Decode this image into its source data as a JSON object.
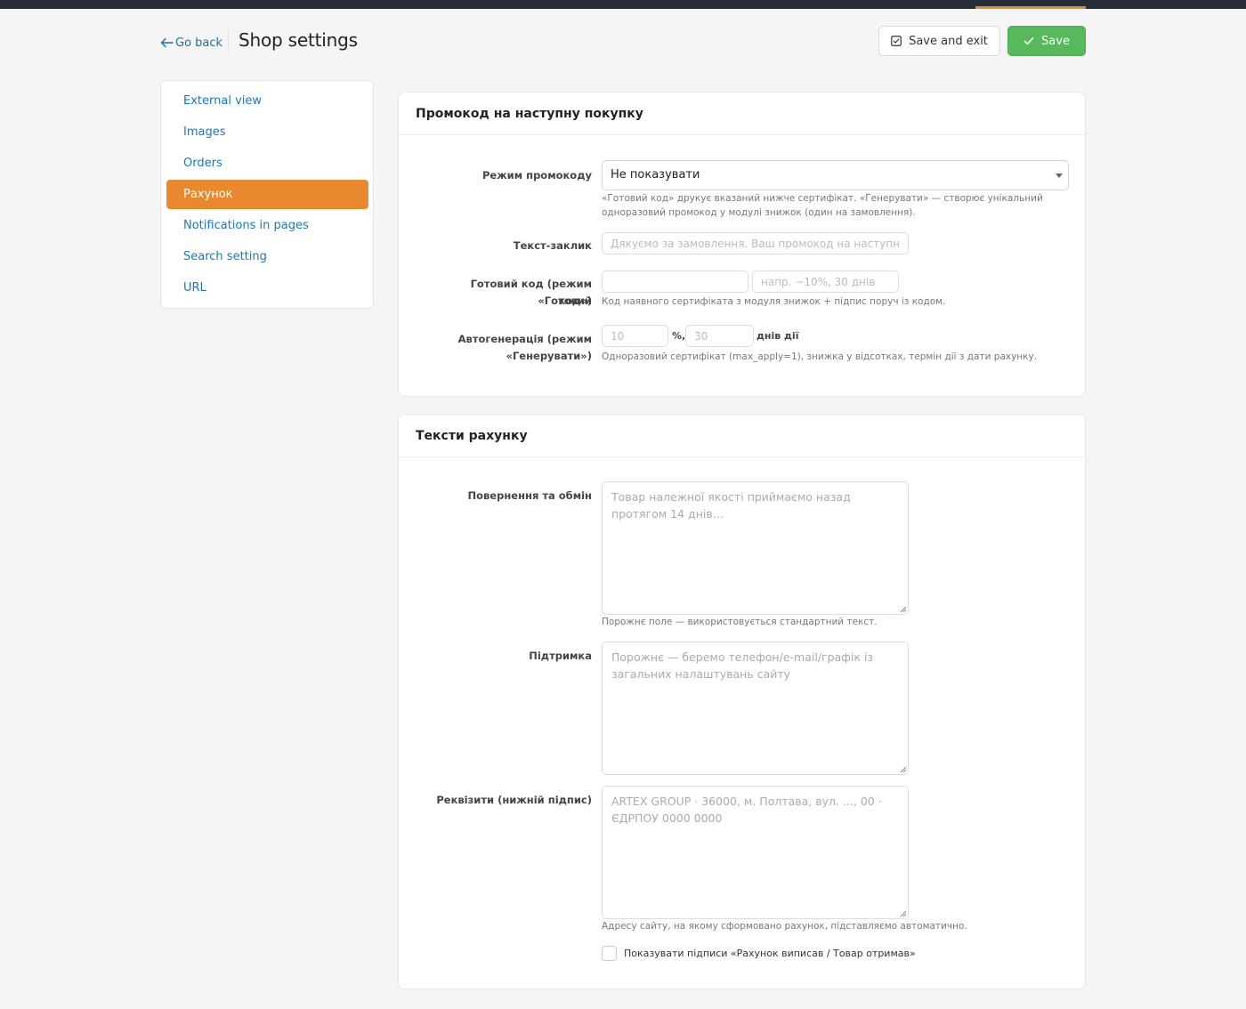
{
  "header": {
    "go_back": "Go back",
    "title": "Shop settings",
    "save_exit": "Save and exit",
    "save": "Save"
  },
  "sidebar": {
    "items": [
      {
        "label": "External view"
      },
      {
        "label": "Images"
      },
      {
        "label": "Orders"
      },
      {
        "label": "Рахунок",
        "active": true
      },
      {
        "label": "Notifications in pages"
      },
      {
        "label": "Search setting"
      },
      {
        "label": "URL"
      }
    ]
  },
  "promo": {
    "title": "Промокод на наступну покупку",
    "mode_label": "Режим промокоду",
    "mode_value": "Не показувати",
    "mode_hint_1": "«Готовий код» друкує вказаний нижче сертифікат. «Генерувати» — створює унікальний",
    "mode_hint_2": "одноразовий промокод у модулі знижок (один на замовлення).",
    "cta_label": "Текст-заклик",
    "cta_placeholder": "Дякуємо за замовлення. Ваш промокод на наступну покупку",
    "ready_label_1": "Готовий код (режим «Готовий",
    "ready_label_2": "код»)",
    "ready_code_value": "",
    "ready_caption_placeholder": "напр. −10%, 30 днів",
    "ready_hint": "Код наявного сертифіката з модуля знижок + підпис поруч із кодом.",
    "auto_label_1": "Автогенерація (режим",
    "auto_label_2": "«Генерувати»)",
    "auto_percent_placeholder": "10",
    "auto_percent_suffix": "%,",
    "auto_days_placeholder": "30",
    "auto_days_suffix": "днів дії",
    "auto_hint": "Одноразовий сертифікат (max_apply=1), знижка у відсотках, термін дії з дати рахунку."
  },
  "texts": {
    "title": "Тексти рахунку",
    "returns_label": "Повернення та обмін",
    "returns_placeholder": "Товар належної якості приймаємо назад протягом 14 днів…",
    "returns_hint": "Порожнє поле — використовується стандартний текст.",
    "support_label": "Підтримка",
    "support_placeholder": "Порожнє — беремо телефон/e-mail/графік із загальних налаштувань сайту",
    "req_label": "Реквізити (нижній підпис)",
    "req_placeholder": "ARTEX GROUP · 36000, м. Полтава, вул. ..., 00 · ЄДРПОУ 0000 0000",
    "req_hint": "Адресу сайту, на якому сформовано рахунок, підставляємо автоматично.",
    "signatures_label": "Показувати підписи «Рахунок виписав / Товар отримав»",
    "signatures_checked": false
  },
  "colors": {
    "accent": "#e8892f",
    "success": "#58b85c",
    "link": "#1a78b5",
    "topbar": "#262d38"
  }
}
